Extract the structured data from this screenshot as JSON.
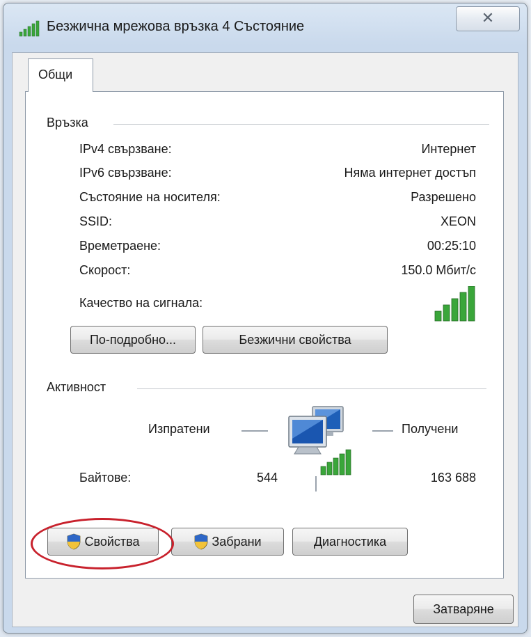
{
  "window": {
    "title": "Безжична мрежова връзка 4 Състояние",
    "close_glyph": "✕"
  },
  "tabs": [
    {
      "label": "Общи",
      "active": true
    }
  ],
  "connection": {
    "group_label": "Връзка",
    "rows": [
      {
        "label": "IPv4 свързване:",
        "value": "Интернет"
      },
      {
        "label": "IPv6 свързване:",
        "value": "Няма интернет достъп"
      },
      {
        "label": "Състояние на носителя:",
        "value": "Разрешено"
      },
      {
        "label": "SSID:",
        "value": "XEON"
      },
      {
        "label": "Времетраене:",
        "value": "00:25:10"
      },
      {
        "label": "Скорост:",
        "value": "150.0 Мбит/с"
      }
    ],
    "signal_label": "Качество на сигнала:",
    "signal_bars": 5,
    "details_button": "По-подробно...",
    "wireless_props_button": "Безжични свойства"
  },
  "activity": {
    "group_label": "Активност",
    "sent_label": "Изпратени",
    "received_label": "Получени",
    "bytes_label": "Байтове:",
    "bytes_sent": "544",
    "bytes_received": "163 688"
  },
  "actions": {
    "properties_button": "Свойства",
    "disable_button": "Забрани",
    "diagnose_button": "Диагностика",
    "close_button": "Затваряне"
  },
  "colors": {
    "signal_green": "#3aa63a",
    "highlight_circle": "#c8212c"
  }
}
